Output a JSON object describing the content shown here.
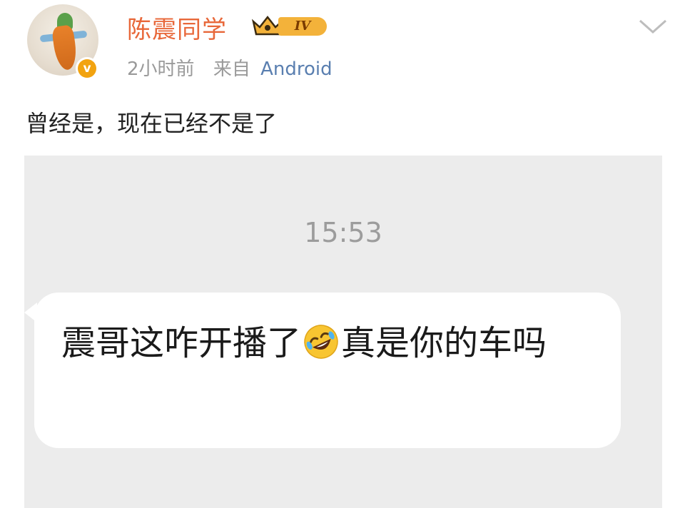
{
  "post": {
    "author": {
      "name": "陈震同学",
      "level_badge": "IV"
    },
    "meta": {
      "time": "2小时前",
      "source_prefix": "来自",
      "source_app": "Android"
    },
    "text": "曾经是，现在已经不是了",
    "image": {
      "chat_time": "15:53",
      "message": {
        "part1": "震哥这咋开播了",
        "emoji": "rolling-on-floor-laughing-emoji",
        "part2": "真是你的车吗"
      }
    }
  },
  "colors": {
    "username": "#e8683a",
    "source_app": "#5a7fb0",
    "meta_gray": "#9a9a9a",
    "verified": "#f2a310",
    "image_bg": "#ececec"
  },
  "icons": {
    "verified": "verified-v-icon",
    "level": "crown-level-icon",
    "more": "chevron-down-icon"
  }
}
